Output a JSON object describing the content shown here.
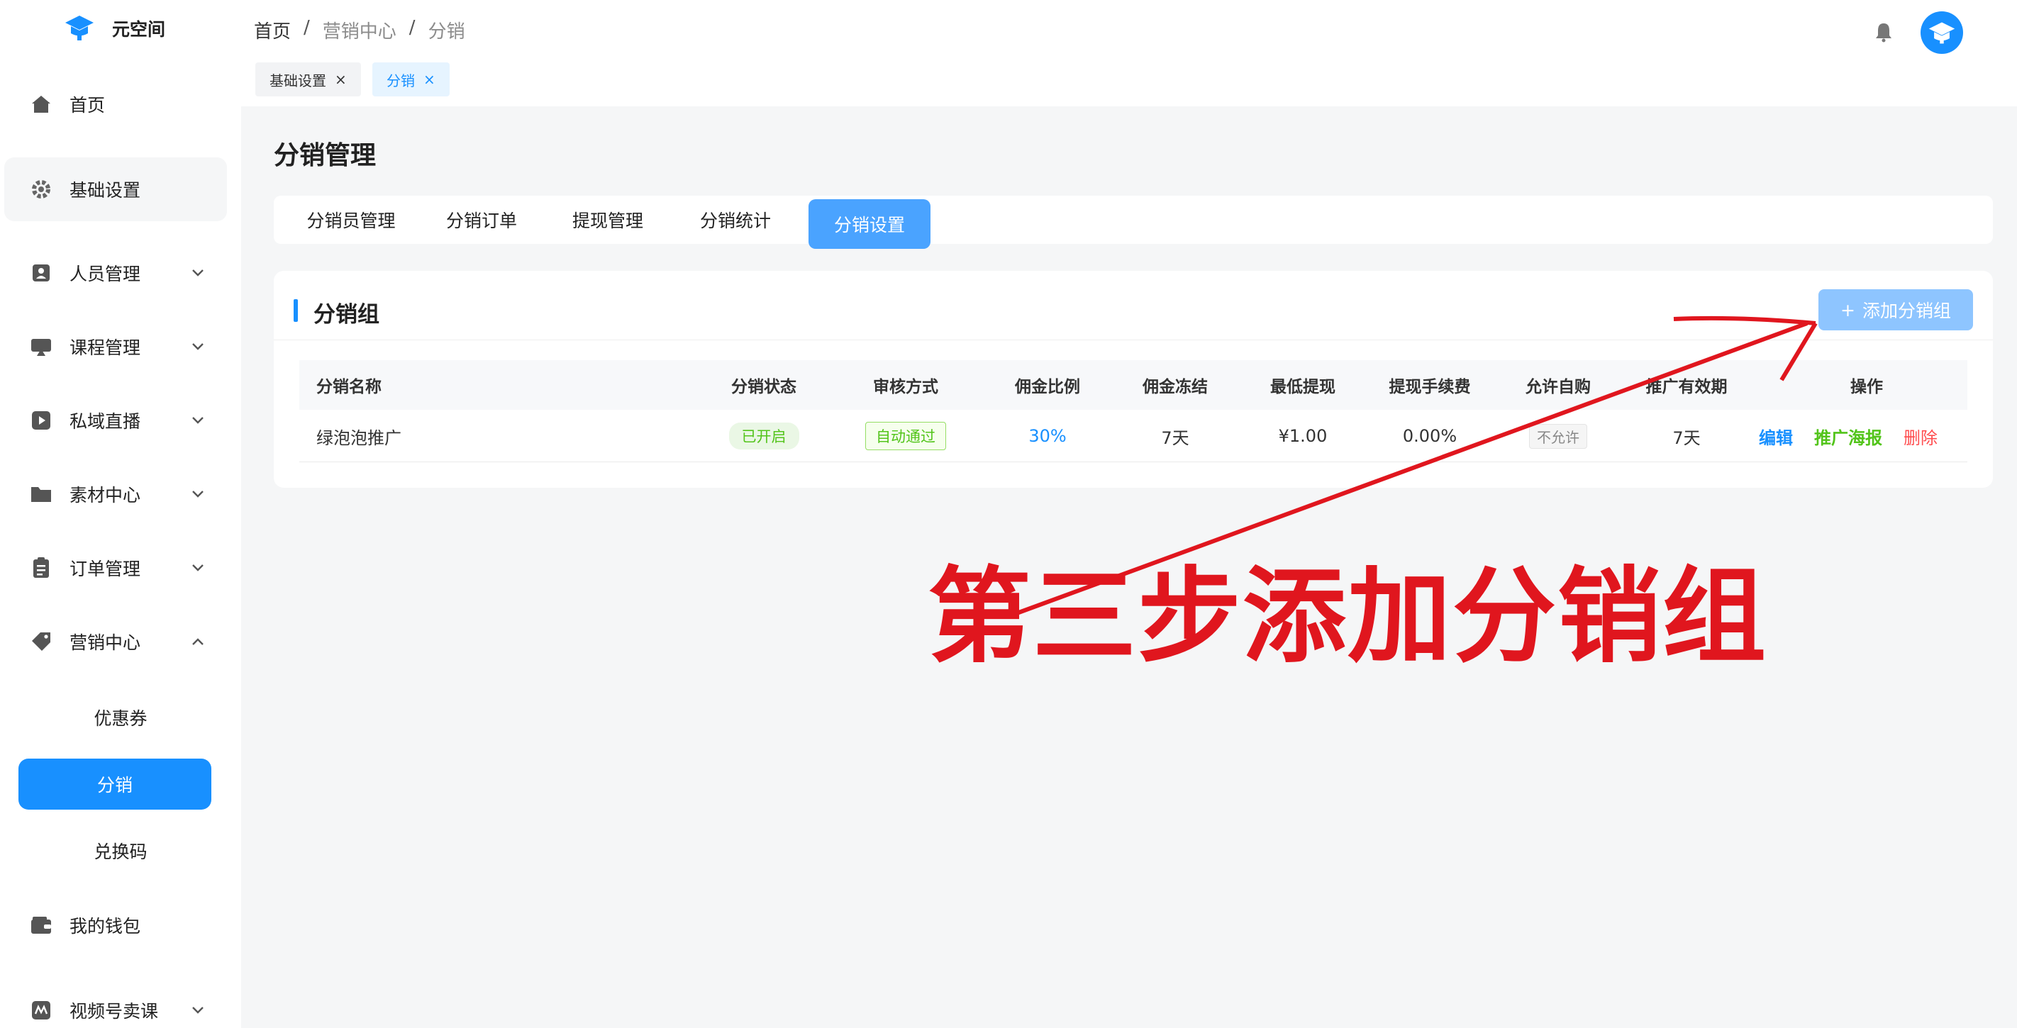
{
  "app": {
    "name": "元空间"
  },
  "sidebar": {
    "items": [
      {
        "label": "首页",
        "icon": "home-icon"
      },
      {
        "label": "基础设置",
        "icon": "gear-icon"
      },
      {
        "label": "人员管理",
        "icon": "person-icon"
      },
      {
        "label": "课程管理",
        "icon": "course-icon"
      },
      {
        "label": "私域直播",
        "icon": "play-icon"
      },
      {
        "label": "素材中心",
        "icon": "folder-icon"
      },
      {
        "label": "订单管理",
        "icon": "clipboard-icon"
      },
      {
        "label": "营销中心",
        "icon": "tag-icon"
      },
      {
        "label": "我的钱包",
        "icon": "wallet-icon"
      },
      {
        "label": "视频号卖课",
        "icon": "video-icon"
      }
    ],
    "marketing_sub": [
      "优惠券",
      "分销",
      "兑换码"
    ]
  },
  "header": {
    "breadcrumb": [
      "首页",
      "营销中心",
      "分销"
    ],
    "breadcrumb_sep": "/",
    "tags": [
      "基础设置",
      "分销"
    ],
    "tag_close": "×"
  },
  "main": {
    "page_title": "分销管理",
    "tabs": [
      "分销员管理",
      "分销订单",
      "提现管理",
      "分销统计",
      "分销设置"
    ],
    "active_tab": "分销设置",
    "panel": {
      "title": "分销组",
      "add_button": "添加分销组",
      "add_icon": "+",
      "columns": [
        "分销名称",
        "分销状态",
        "审核方式",
        "佣金比例",
        "佣金冻结",
        "最低提现",
        "提现手续费",
        "允许自购",
        "推广有效期",
        "操作"
      ],
      "rows": [
        {
          "name": "绿泡泡推广",
          "status": "已开启",
          "review": "自动通过",
          "commission": "30%",
          "freeze": "7天",
          "min_withdraw": "¥1.00",
          "fee": "0.00%",
          "self_buy": "不允许",
          "validity": "7天",
          "actions": [
            "编辑",
            "推广海报",
            "删除"
          ]
        }
      ]
    }
  },
  "annotation": {
    "text": "第三步添加分销组",
    "color": "#e0161e"
  },
  "colors": {
    "primary": "#1890ff",
    "green": "#52c41a",
    "red": "#ff4d4f",
    "annotation": "#e0161e"
  }
}
